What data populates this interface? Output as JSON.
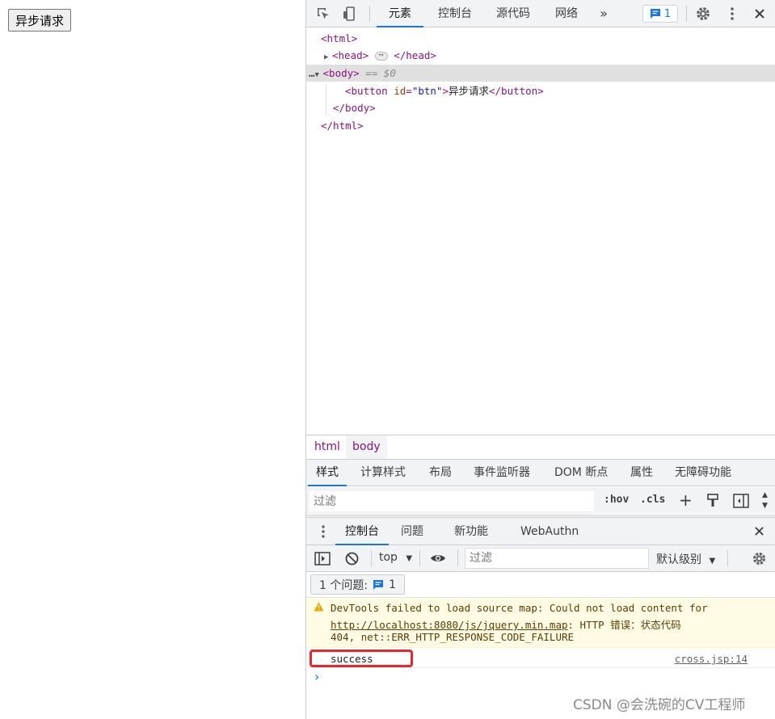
{
  "page": {
    "button_label": "异步请求"
  },
  "devtools": {
    "tabs": [
      "元素",
      "控制台",
      "源代码",
      "网络"
    ],
    "more_tabs": "»",
    "issue_count": "1",
    "tree": {
      "html_open": "<html>",
      "head_open": "<head>",
      "head_dots": "⋯",
      "head_close": "</head>",
      "body_dots": "…",
      "body_open": "<body>",
      "body_selected_suffix": "== $0",
      "button_tag_start": "<button ",
      "button_attr_name": "id",
      "button_attr_eq": "=",
      "button_attr_value": "\"btn\"",
      "button_tag_gt": ">",
      "button_text": "异步请求",
      "button_close": "</button>",
      "body_close": "</body>",
      "html_close": "</html>"
    },
    "breadcrumbs": [
      "html",
      "body"
    ],
    "style_tabs": [
      "样式",
      "计算样式",
      "布局",
      "事件监听器",
      "DOM 断点",
      "属性",
      "无障碍功能"
    ],
    "filter_placeholder": "过滤",
    "hov": ":hov",
    "cls": ".cls",
    "drawer_tabs": [
      "控制台",
      "问题",
      "新功能",
      "WebAuthn"
    ],
    "context": "top",
    "console_filter_placeholder": "过滤",
    "levels": "默认级别",
    "issues_label": "1 个问题:",
    "issues_count": "1",
    "warning": {
      "line1": "DevTools failed to load source map: Could not load content for",
      "link": "http://localhost:8080/js/jquery.min.map",
      "line2_rest": ": HTTP 错误：状态代码",
      "line3": "404, net::ERR_HTTP_RESPONSE_CODE_FAILURE"
    },
    "log": {
      "message": "success",
      "source": "cross.jsp:14"
    },
    "prompt": "›"
  },
  "watermark": "CSDN @会洗碗的CV工程师",
  "colors": {
    "accent": "#1a73e8",
    "tag": "#881280",
    "highlight": "#e8262b",
    "warning_bg": "#fffbe5"
  }
}
